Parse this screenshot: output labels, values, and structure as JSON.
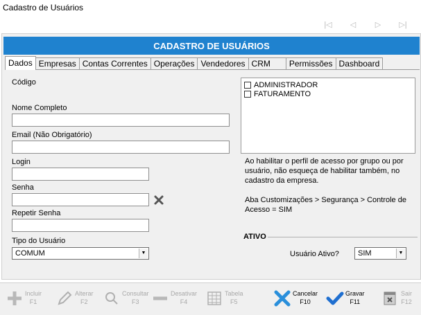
{
  "window": {
    "title": "Cadastro de Usuários"
  },
  "nav": {
    "first": "first-record-icon",
    "prev": "prev-record-icon",
    "next": "next-record-icon",
    "last": "last-record-icon"
  },
  "header": {
    "banner": "CADASTRO DE USUÁRIOS"
  },
  "tabs": [
    {
      "label": "Dados"
    },
    {
      "label": "Empresas"
    },
    {
      "label": "Contas Correntes"
    },
    {
      "label": "Operações"
    },
    {
      "label": "Vendedores"
    },
    {
      "label": "CRM"
    },
    {
      "label": "Permissões"
    },
    {
      "label": "Dashboard"
    }
  ],
  "form": {
    "codigo_label": "Código",
    "nome_label": "Nome Completo",
    "nome_value": "",
    "email_label": "Email   (Não Obrigatório)",
    "email_value": "",
    "login_label": "Login",
    "login_value": "",
    "senha_label": "Senha",
    "senha_value": "",
    "repetir_label": "Repetir Senha",
    "repetir_value": "",
    "tipo_label": "Tipo do Usuário",
    "tipo_value": "COMUM"
  },
  "profiles": [
    {
      "label": "ADMINISTRADOR",
      "checked": false
    },
    {
      "label": "FATURAMENTO",
      "checked": false
    }
  ],
  "info": {
    "line1": "Ao habilitar o perfil de acesso por grupo ou por usuário, não esqueça de habilitar também, no cadastro da empresa.",
    "line2": "Aba Customizações > Segurança > Controle de Acesso = SIM"
  },
  "ativo": {
    "section_title": "ATIVO",
    "label": "Usuário Ativo?",
    "value": "SIM"
  },
  "toolbar": {
    "incluir": {
      "label": "Incluir",
      "key": "F1"
    },
    "alterar": {
      "label": "Alterar",
      "key": "F2"
    },
    "consultar": {
      "label": "Consultar",
      "key": "F3"
    },
    "desativar": {
      "label": "Desativar",
      "key": "F4"
    },
    "tabela": {
      "label": "Tabela",
      "key": "F5"
    },
    "cancelar": {
      "label": "Cancelar",
      "key": "F10"
    },
    "gravar": {
      "label": "Gravar",
      "key": "F11"
    },
    "sair": {
      "label": "Sair",
      "key": "F12"
    }
  },
  "colors": {
    "banner": "#1f82cf",
    "cancel": "#1f82cf",
    "save": "#1f82cf",
    "disabled": "#a8a8a8"
  }
}
